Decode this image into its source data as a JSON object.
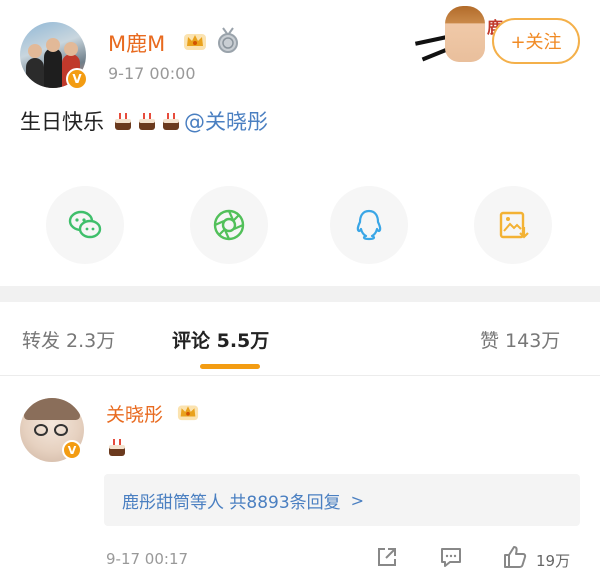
{
  "post": {
    "username": "M鹿M",
    "time": "9-17 00:00",
    "text": "生日快乐",
    "mention": "@关晓彤",
    "follow_label": "+关注"
  },
  "share": {
    "icons": [
      "wechat-icon",
      "moments-icon",
      "qq-icon",
      "save-image-icon"
    ]
  },
  "tabs": {
    "repost": "转发 2.3万",
    "comment": "评论 5.5万",
    "like": "赞 143万"
  },
  "comment": {
    "username": "关晓彤",
    "reply_summary": "鹿彤甜筒等人 共8893条回复",
    "reply_chevron": ">",
    "time": "9-17 00:17",
    "like_count": "19万"
  },
  "colors": {
    "accent": "#f39c12",
    "username": "#e86a1f",
    "link": "#4a7fc1",
    "wechat": "#3fbf6b",
    "moments": "#52c05a",
    "qq": "#3aa6e6",
    "save": "#f3b234"
  }
}
